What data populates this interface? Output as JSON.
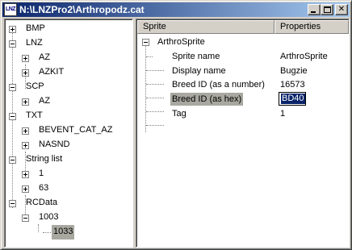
{
  "window": {
    "title": "N:\\LNZPro2\\Arthropodz.cat",
    "icon_label": "LNZ"
  },
  "tree": {
    "items": [
      {
        "label": "BMP"
      },
      {
        "label": "LNZ"
      },
      {
        "label": "AZ"
      },
      {
        "label": "AZKIT"
      },
      {
        "label": "SCP"
      },
      {
        "label": "AZ"
      },
      {
        "label": "TXT"
      },
      {
        "label": "BEVENT_CAT_AZ"
      },
      {
        "label": "NASND"
      },
      {
        "label": "String list"
      },
      {
        "label": "1"
      },
      {
        "label": "63"
      },
      {
        "label": "RCData"
      },
      {
        "label": "1003"
      },
      {
        "label": "1033"
      }
    ]
  },
  "properties": {
    "columns": [
      "Sprite",
      "Properties"
    ],
    "root": "ArthroSprite",
    "rows": [
      {
        "label": "Sprite name",
        "value": "ArthroSprite"
      },
      {
        "label": "Display name",
        "value": "Bugzie"
      },
      {
        "label": "Breed ID (as a number)",
        "value": "16573"
      },
      {
        "label": "Breed ID (as hex)",
        "value": "BD40"
      },
      {
        "label": "Tag",
        "value": "1"
      }
    ]
  }
}
